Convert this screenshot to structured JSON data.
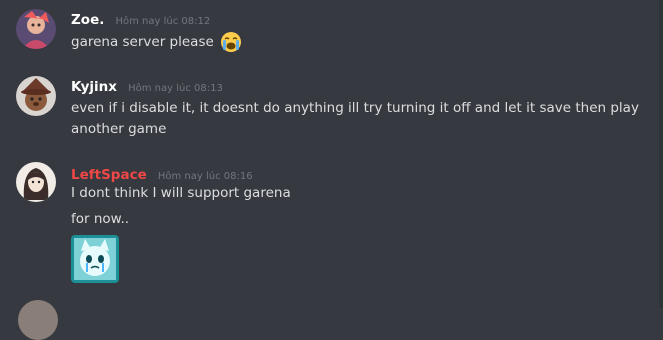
{
  "messages": [
    {
      "username": "Zoe.",
      "username_color": "#ffffff",
      "timestamp": "Hôm nay lúc 08:12",
      "lines": [
        "garena server please"
      ],
      "emoji": "loudly-crying-face"
    },
    {
      "username": "Kyjinx",
      "username_color": "#ffffff",
      "timestamp": "Hôm nay lúc 08:13",
      "lines": [
        "even if i disable it, it doesnt do anything ill try turning it off and let it save then play",
        "another game"
      ]
    },
    {
      "username": "LeftSpace",
      "username_color": "#f04747",
      "timestamp": "Hôm nay lúc 08:16",
      "lines": [
        "I dont think I will support garena",
        "for now.."
      ],
      "sticker": "crying-cat-sticker"
    }
  ],
  "colors": {
    "background": "#36393f",
    "text": "#dcddde",
    "timestamp": "#72767d",
    "leftspace_name": "#f04747"
  }
}
